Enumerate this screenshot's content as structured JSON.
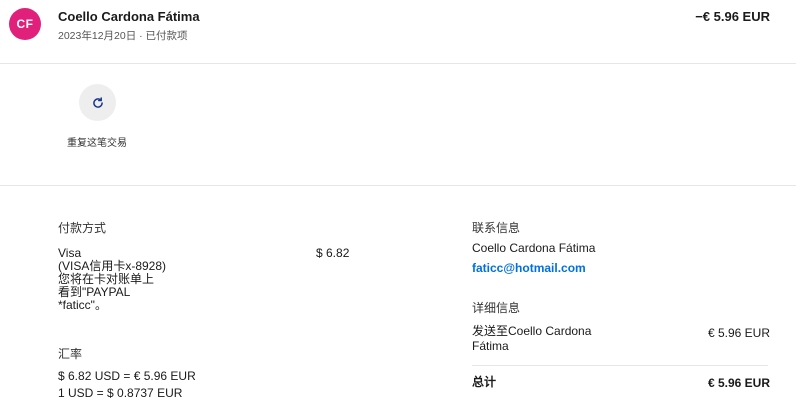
{
  "header": {
    "avatar_initials": "CF",
    "merchant": "Coello Cardona Fátima",
    "meta": "2023年12月20日 · 已付款项",
    "amount": "−€ 5.96 EUR",
    "avatar_color": "#e0207a"
  },
  "actions": {
    "repeat_icon": "refresh-icon",
    "repeat_label": "重复这笔交易"
  },
  "payment": {
    "heading": "付款方式",
    "method": "Visa",
    "card": "(VISA信用卡x-8928)",
    "note_1": "您将在卡对账单上",
    "note_2": "看到\"PAYPAL",
    "note_3": "*faticc\"。",
    "amount": "$ 6.82"
  },
  "exchange": {
    "heading": "汇率",
    "line_1": "$ 6.82 USD = € 5.96 EUR",
    "line_2": "1 USD = $ 0.8737 EUR"
  },
  "contact": {
    "heading": "联系信息",
    "name": "Coello Cardona Fátima",
    "email": "faticc@hotmail.com"
  },
  "details": {
    "heading": "详细信息",
    "sent_to_1": "发送至Coello Cardona",
    "sent_to_2": "Fátima",
    "sent_amount": "€ 5.96 EUR",
    "total_label": "总计",
    "total_amount": "€ 5.96 EUR"
  },
  "colors": {
    "link": "#0070e0",
    "divider": "#e6e6e6"
  }
}
